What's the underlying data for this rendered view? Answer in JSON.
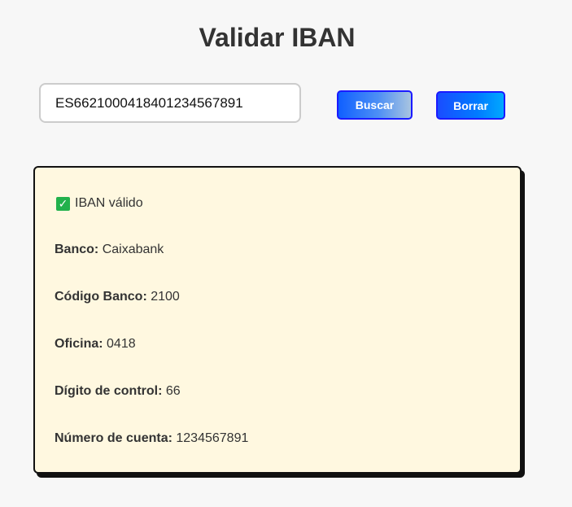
{
  "page": {
    "title": "Validar IBAN"
  },
  "search": {
    "value": "ES6621000418401234567891",
    "search_label": "Buscar",
    "clear_label": "Borrar"
  },
  "result": {
    "status_icon": "check-icon",
    "status_text": "IBAN válido",
    "fields": [
      {
        "label": "Banco:",
        "value": "Caixabank"
      },
      {
        "label": "Código Banco:",
        "value": "2100"
      },
      {
        "label": "Oficina:",
        "value": "0418"
      },
      {
        "label": "Dígito de control:",
        "value": "66"
      },
      {
        "label": "Número de cuenta:",
        "value": "1234567891"
      }
    ]
  },
  "colors": {
    "background": "#f7f7f7",
    "card_background": "#fff8e0",
    "button_border": "#1a1aff",
    "check_green": "#22b14c"
  }
}
